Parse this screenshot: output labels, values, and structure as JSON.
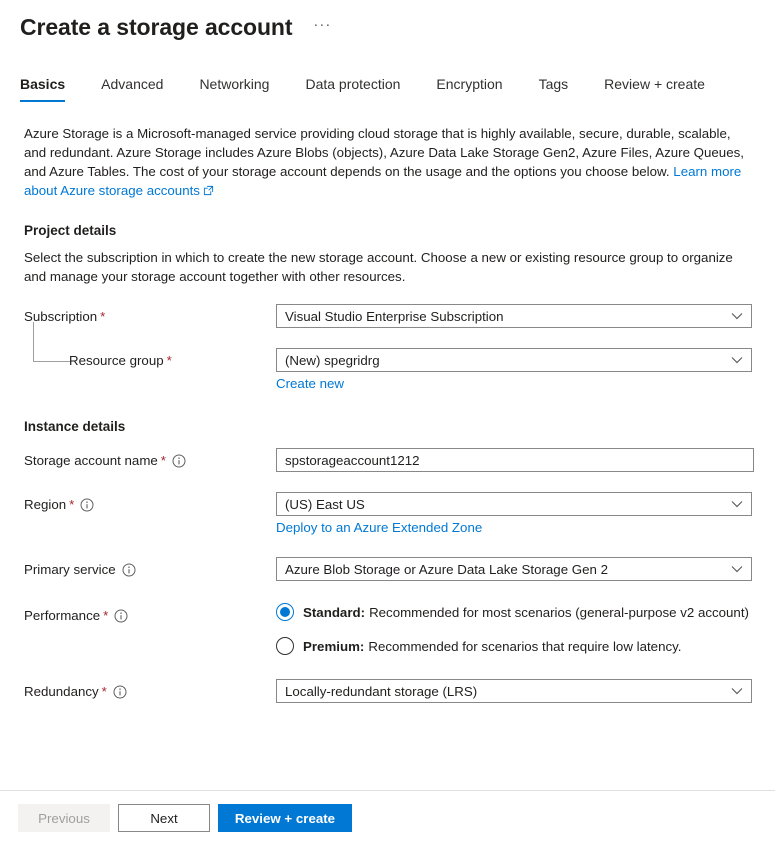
{
  "header": {
    "title": "Create a storage account",
    "more_options": "···"
  },
  "tabs": [
    {
      "label": "Basics",
      "active": true
    },
    {
      "label": "Advanced",
      "active": false
    },
    {
      "label": "Networking",
      "active": false
    },
    {
      "label": "Data protection",
      "active": false
    },
    {
      "label": "Encryption",
      "active": false
    },
    {
      "label": "Tags",
      "active": false
    },
    {
      "label": "Review + create",
      "active": false
    }
  ],
  "intro": {
    "text": "Azure Storage is a Microsoft-managed service providing cloud storage that is highly available, secure, durable, scalable, and redundant. Azure Storage includes Azure Blobs (objects), Azure Data Lake Storage Gen2, Azure Files, Azure Queues, and Azure Tables. The cost of your storage account depends on the usage and the options you choose below. ",
    "link_text": "Learn more about Azure storage accounts"
  },
  "project_details": {
    "heading": "Project details",
    "description": "Select the subscription in which to create the new storage account. Choose a new or existing resource group to organize and manage your storage account together with other resources.",
    "subscription": {
      "label": "Subscription",
      "required": "*",
      "value": "Visual Studio Enterprise Subscription"
    },
    "resource_group": {
      "label": "Resource group",
      "required": "*",
      "value": "(New) spegridrg",
      "create_new_link": "Create new"
    }
  },
  "instance_details": {
    "heading": "Instance details",
    "storage_account_name": {
      "label": "Storage account name",
      "required": "*",
      "value": "spstorageaccount1212",
      "placeholder": ""
    },
    "region": {
      "label": "Region",
      "required": "*",
      "value": "(US) East US",
      "sublink": "Deploy to an Azure Extended Zone"
    },
    "primary_service": {
      "label": "Primary service",
      "value": "Azure Blob Storage or Azure Data Lake Storage Gen 2"
    },
    "performance": {
      "label": "Performance",
      "required": "*",
      "options": [
        {
          "name": "Standard:",
          "description": "Recommended for most scenarios (general-purpose v2 account)",
          "selected": true
        },
        {
          "name": "Premium:",
          "description": "Recommended for scenarios that require low latency.",
          "selected": false
        }
      ]
    },
    "redundancy": {
      "label": "Redundancy",
      "required": "*",
      "value": "Locally-redundant storage (LRS)"
    }
  },
  "footer": {
    "previous": "Previous",
    "next": "Next",
    "review_create": "Review + create"
  },
  "colors": {
    "accent": "#0078d4",
    "required_asterisk": "#a4262c",
    "border": "#8a8886",
    "text": "#201f1e",
    "disabled_bg": "#f3f2f1",
    "disabled_text": "#a19f9d"
  }
}
